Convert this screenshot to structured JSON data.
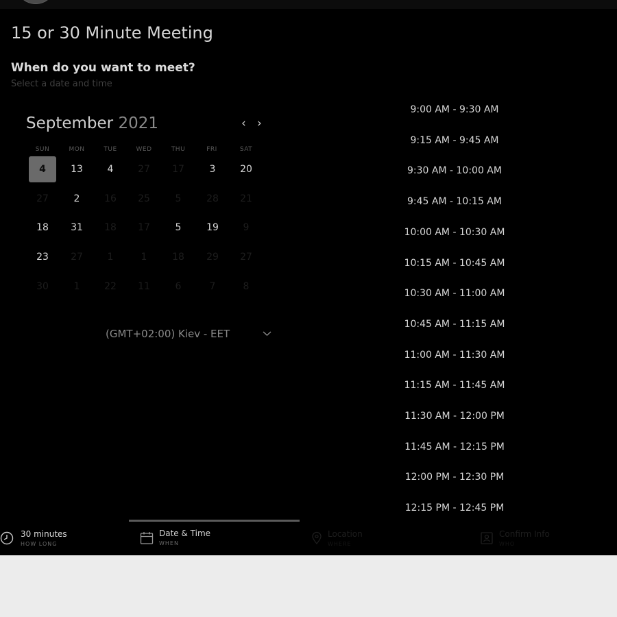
{
  "header": {
    "title": "15 or 30 Minute Meeting"
  },
  "prompt": {
    "question": "When do you want to meet?",
    "subtitle": "Select a date and time"
  },
  "calendar": {
    "month": "September",
    "year": "2021",
    "prev_arrow": "‹",
    "next_arrow": "›",
    "weekdays": [
      "SUN",
      "MON",
      "TUE",
      "WED",
      "THU",
      "FRI",
      "SAT"
    ],
    "weeks": [
      [
        {
          "label": "4",
          "available": true,
          "selected": true
        },
        {
          "label": "13",
          "available": true
        },
        {
          "label": "4",
          "available": true
        },
        {
          "label": "27",
          "available": false
        },
        {
          "label": "17",
          "available": false
        },
        {
          "label": "3",
          "available": true
        },
        {
          "label": "20",
          "available": true
        }
      ],
      [
        {
          "label": "27",
          "available": false
        },
        {
          "label": "2",
          "available": true
        },
        {
          "label": "16",
          "available": false
        },
        {
          "label": "25",
          "available": false
        },
        {
          "label": "5",
          "available": false
        },
        {
          "label": "28",
          "available": false
        },
        {
          "label": "21",
          "available": false
        }
      ],
      [
        {
          "label": "18",
          "available": true
        },
        {
          "label": "31",
          "available": true
        },
        {
          "label": "18",
          "available": false
        },
        {
          "label": "17",
          "available": false
        },
        {
          "label": "5",
          "available": true
        },
        {
          "label": "19",
          "available": true
        },
        {
          "label": "9",
          "available": false
        }
      ],
      [
        {
          "label": "23",
          "available": true
        },
        {
          "label": "27",
          "available": false
        },
        {
          "label": "1",
          "available": false
        },
        {
          "label": "1",
          "available": false
        },
        {
          "label": "18",
          "available": false
        },
        {
          "label": "29",
          "available": false
        },
        {
          "label": "27",
          "available": false
        }
      ],
      [
        {
          "label": "30",
          "available": false
        },
        {
          "label": "1",
          "available": false
        },
        {
          "label": "22",
          "available": false
        },
        {
          "label": "11",
          "available": false
        },
        {
          "label": "6",
          "available": false
        },
        {
          "label": "7",
          "available": false
        },
        {
          "label": "8",
          "available": false
        }
      ]
    ]
  },
  "timezone": {
    "label": "(GMT+02:00) Kiev - EET"
  },
  "time_slots": [
    "9:00 AM - 9:30 AM",
    "9:15 AM - 9:45 AM",
    "9:30 AM - 10:00 AM",
    "9:45 AM - 10:15 AM",
    "10:00 AM - 10:30 AM",
    "10:15 AM - 10:45 AM",
    "10:30 AM - 11:00 AM",
    "10:45 AM - 11:15 AM",
    "11:00 AM - 11:30 AM",
    "11:15 AM - 11:45 AM",
    "11:30 AM - 12:00 PM",
    "11:45 AM - 12:15 PM",
    "12:00 PM - 12:30 PM",
    "12:15 PM - 12:45 PM"
  ],
  "steps": [
    {
      "label": "30 minutes",
      "sub": "HOW LONG",
      "icon": "clock-icon",
      "active": false,
      "done": true
    },
    {
      "label": "Date & Time",
      "sub": "WHEN",
      "icon": "calendar-icon",
      "active": true,
      "done": false
    },
    {
      "label": "Location",
      "sub": "WHERE",
      "icon": "location-pin-icon",
      "active": false,
      "done": false
    },
    {
      "label": "Confirm Info",
      "sub": "WHO",
      "icon": "user-card-icon",
      "active": false,
      "done": false
    }
  ],
  "colors": {
    "background": "#000000",
    "selected_day": "#6a6a6a",
    "active_tab_indicator": "#5a5a5a",
    "page_below": "#ececec"
  }
}
